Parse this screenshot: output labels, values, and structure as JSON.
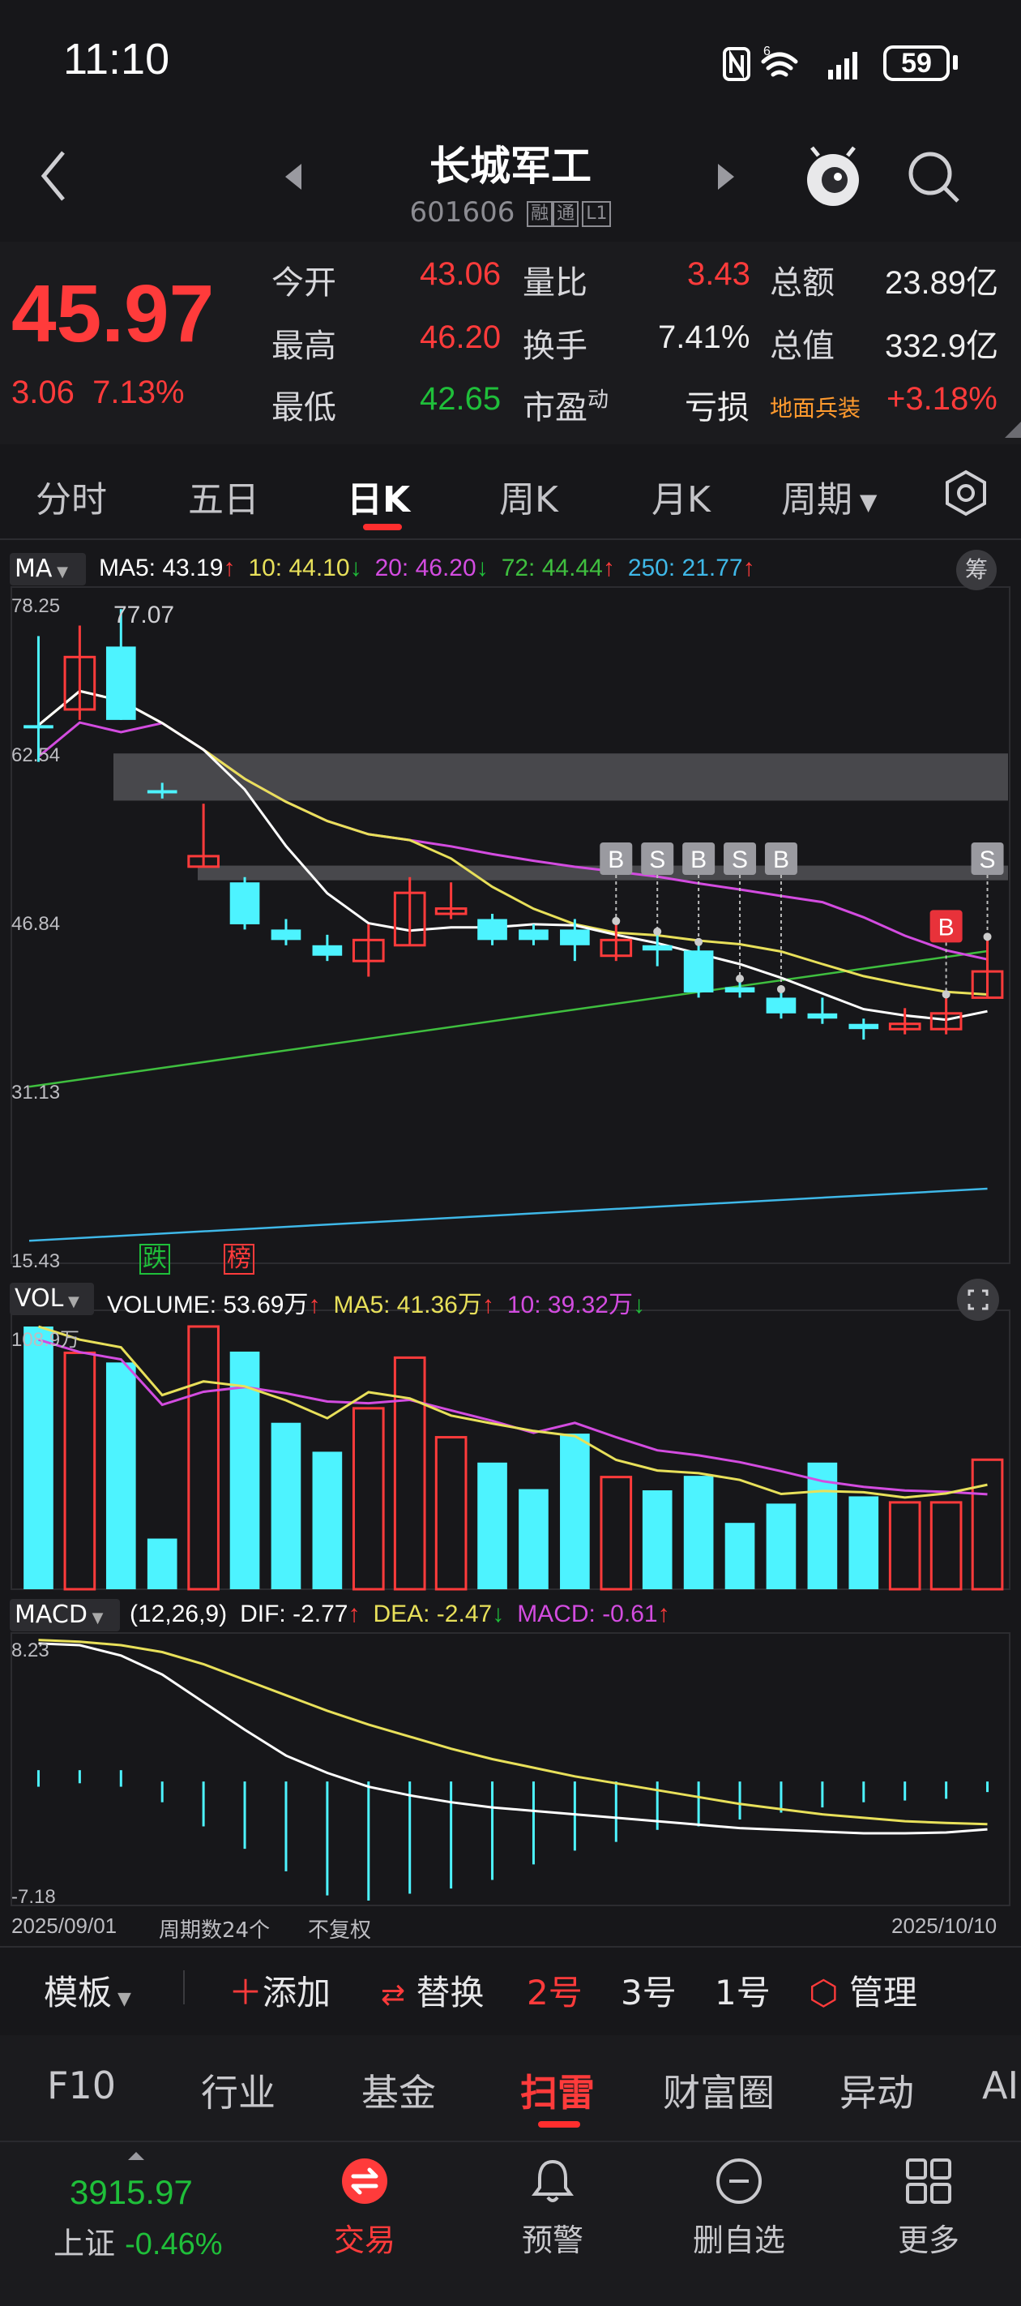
{
  "status": {
    "time": "11:10",
    "battery": "59",
    "network": "6"
  },
  "header": {
    "title": "长城军工",
    "code": "601606",
    "tags": [
      "融",
      "通",
      "L1"
    ]
  },
  "quote": {
    "price": "45.97",
    "change": "3.06",
    "change_pct": "7.13%",
    "rows": [
      [
        {
          "label": "今开",
          "value": "43.06",
          "color": "#ff3b3b"
        },
        {
          "label": "量比",
          "value": "3.43",
          "color": "#ff3b3b"
        },
        {
          "label": "总额",
          "value": "23.89亿",
          "color": "#f0f0f0"
        }
      ],
      [
        {
          "label": "最高",
          "value": "46.20",
          "color": "#ff3b3b"
        },
        {
          "label": "换手",
          "value": "7.41%",
          "color": "#f0f0f0"
        },
        {
          "label": "总值",
          "value": "332.9亿",
          "color": "#f0f0f0"
        }
      ],
      [
        {
          "label": "最低",
          "value": "42.65",
          "color": "#1fbf3a"
        },
        {
          "label": "市盈动",
          "value": "亏损",
          "color": "#f0f0f0"
        },
        {
          "label": "地面兵装",
          "value": "+3.18%",
          "color": "#ff3b3b"
        }
      ]
    ]
  },
  "tabs": [
    "分时",
    "五日",
    "日K",
    "周K",
    "月K",
    "周期"
  ],
  "tabs_active": "日K",
  "ma_legend": {
    "label": "MA",
    "items": [
      {
        "text": "MA5: 43.19",
        "color": "#ffffff",
        "arrow": "↑",
        "arrow_color": "#ff3b3b"
      },
      {
        "text": "10: 44.10",
        "color": "#e8e05a",
        "arrow": "↓",
        "arrow_color": "#1fbf3a"
      },
      {
        "text": "20: 46.20",
        "color": "#d34ce0",
        "arrow": "↓",
        "arrow_color": "#1fbf3a"
      },
      {
        "text": "72: 44.44",
        "color": "#3fbf3f",
        "arrow": "↑",
        "arrow_color": "#ff3b3b"
      },
      {
        "text": "250: 21.77",
        "color": "#3fb8e8",
        "arrow": "↑",
        "arrow_color": "#ff3b3b"
      }
    ],
    "chip": "筹"
  },
  "price_axis": [
    "78.25",
    "62.54",
    "46.84",
    "31.13",
    "15.43"
  ],
  "high_label": "77.07",
  "markers_bottom": [
    {
      "text": "跌",
      "color": "#1fbf3a"
    },
    {
      "text": "榜",
      "color": "#ff3b3b"
    }
  ],
  "vol_legend": {
    "label": "VOL",
    "items": [
      {
        "text": "VOLUME: 53.69万",
        "color": "#ffffff",
        "arrow": "↑",
        "arrow_color": "#ff3b3b"
      },
      {
        "text": "MA5: 41.36万",
        "color": "#e8e05a",
        "arrow": "↑",
        "arrow_color": "#ff3b3b"
      },
      {
        "text": "10: 39.32万",
        "color": "#d34ce0",
        "arrow": "↓",
        "arrow_color": "#1fbf3a"
      }
    ],
    "axis_top": "108.9万"
  },
  "macd_legend": {
    "label": "MACD",
    "items": [
      {
        "text": "(12,26,9)",
        "color": "#ffffff",
        "arrow": "",
        "arrow_color": "#ffffff"
      },
      {
        "text": "DIF: -2.77",
        "color": "#ffffff",
        "arrow": "↑",
        "arrow_color": "#ff3b3b"
      },
      {
        "text": "DEA: -2.47",
        "color": "#e8e05a",
        "arrow": "↓",
        "arrow_color": "#1fbf3a"
      },
      {
        "text": "MACD: -0.61",
        "color": "#d34ce0",
        "arrow": "↑",
        "arrow_color": "#ff3b3b"
      }
    ],
    "axis_top": "8.23",
    "axis_bottom": "-7.18"
  },
  "footer_axis": {
    "start": "2025/09/01",
    "count": "周期数24个",
    "adjust": "不复权",
    "end": "2025/10/10"
  },
  "chart_data": {
    "type": "candlestick",
    "ylim": [
      15.43,
      78.25
    ],
    "candles": [
      {
        "o": 66.0,
        "c": 66.0,
        "h": 74.5,
        "l": 62.5,
        "up": false
      },
      {
        "o": 67.5,
        "c": 72.5,
        "h": 75.5,
        "l": 66.5,
        "up": true
      },
      {
        "o": 73.5,
        "c": 66.5,
        "h": 77.07,
        "l": 66.5,
        "up": false
      },
      {
        "o": 59.8,
        "c": 59.8,
        "h": 60.5,
        "l": 59.0,
        "up": false
      },
      {
        "o": 52.5,
        "c": 53.5,
        "h": 58.5,
        "l": 52.5,
        "up": true
      },
      {
        "o": 51.0,
        "c": 47.0,
        "h": 51.5,
        "l": 46.5,
        "up": false
      },
      {
        "o": 46.5,
        "c": 45.5,
        "h": 47.5,
        "l": 45.0,
        "up": false
      },
      {
        "o": 45.0,
        "c": 44.0,
        "h": 46.0,
        "l": 43.5,
        "up": false
      },
      {
        "o": 43.5,
        "c": 45.5,
        "h": 47.0,
        "l": 42.0,
        "up": true
      },
      {
        "o": 45.0,
        "c": 50.0,
        "h": 51.5,
        "l": 45.0,
        "up": true
      },
      {
        "o": 48.0,
        "c": 48.5,
        "h": 51.0,
        "l": 47.5,
        "up": true
      },
      {
        "o": 47.5,
        "c": 45.5,
        "h": 48.0,
        "l": 45.0,
        "up": false
      },
      {
        "o": 46.5,
        "c": 45.5,
        "h": 47.0,
        "l": 45.0,
        "up": false
      },
      {
        "o": 46.5,
        "c": 45.0,
        "h": 47.5,
        "l": 43.5,
        "up": false
      },
      {
        "o": 44.0,
        "c": 45.5,
        "h": 47.0,
        "l": 43.5,
        "up": true
      },
      {
        "o": 45.0,
        "c": 44.5,
        "h": 46.0,
        "l": 43.0,
        "up": false
      },
      {
        "o": 44.5,
        "c": 40.5,
        "h": 45.0,
        "l": 40.0,
        "up": false
      },
      {
        "o": 41.0,
        "c": 40.5,
        "h": 41.5,
        "l": 40.0,
        "up": false
      },
      {
        "o": 40.0,
        "c": 38.5,
        "h": 40.5,
        "l": 38.0,
        "up": false
      },
      {
        "o": 38.5,
        "c": 38.0,
        "h": 40.0,
        "l": 37.5,
        "up": false
      },
      {
        "o": 37.5,
        "c": 37.0,
        "h": 38.0,
        "l": 36.0,
        "up": false
      },
      {
        "o": 37.0,
        "c": 37.5,
        "h": 39.0,
        "l": 36.5,
        "up": true
      },
      {
        "o": 37.0,
        "c": 38.5,
        "h": 40.0,
        "l": 36.5,
        "up": true
      },
      {
        "o": 40.0,
        "c": 42.5,
        "h": 45.5,
        "l": 40.0,
        "up": true
      }
    ],
    "volume": [
      108.9,
      98.0,
      94.0,
      21.0,
      108.9,
      98.5,
      69.0,
      57.0,
      75.0,
      96.0,
      63.0,
      52.5,
      41.5,
      64.5,
      46.5,
      41.0,
      47.0,
      27.5,
      35.5,
      52.5,
      38.5,
      36.0,
      36.0,
      53.69
    ],
    "volume_up": [
      false,
      true,
      false,
      false,
      true,
      false,
      false,
      false,
      true,
      true,
      true,
      false,
      false,
      false,
      true,
      false,
      false,
      false,
      false,
      false,
      false,
      true,
      true,
      true
    ],
    "volume_ylim": [
      0,
      108.9
    ],
    "macd_ylim": [
      -7.18,
      8.23
    ],
    "bs_markers": [
      "B",
      "S",
      "B",
      "S",
      "B",
      "B",
      "S"
    ]
  },
  "toolbar": {
    "template": "模板",
    "add": "添加",
    "replace": "替换",
    "slot2": "2号",
    "slot3": "3号",
    "slot1": "1号",
    "manage": "管理"
  },
  "sub_tabs": [
    "F10",
    "行业",
    "基金",
    "扫雷",
    "财富圈",
    "异动",
    "AI"
  ],
  "nav": {
    "index_value": "3915.97",
    "index_name": "上证",
    "index_chg": "-0.46%",
    "trade": "交易",
    "alert": "预警",
    "remove": "删自选",
    "more": "更多"
  }
}
